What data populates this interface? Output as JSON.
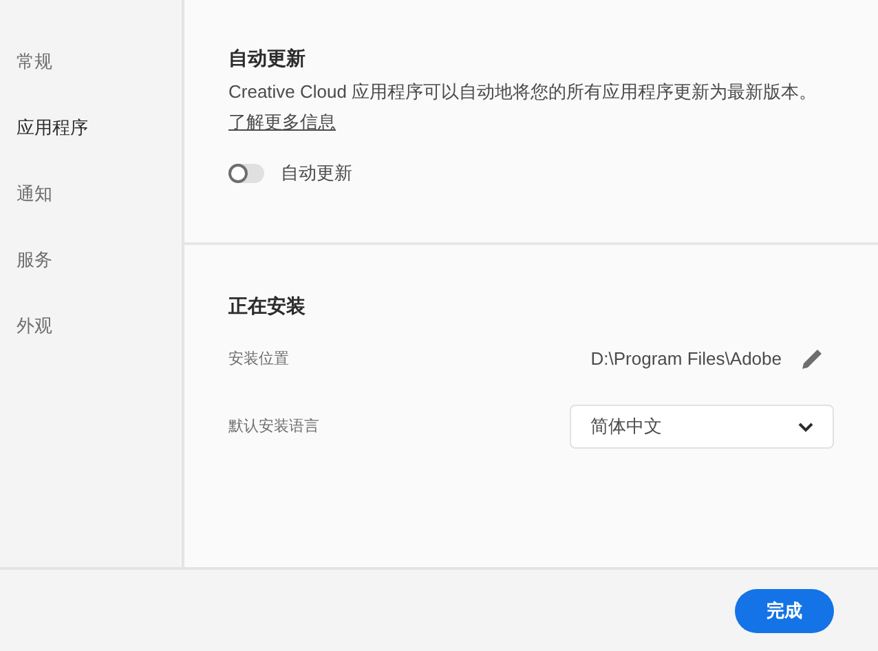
{
  "sidebar": {
    "items": [
      {
        "label": "常规",
        "selected": false
      },
      {
        "label": "应用程序",
        "selected": true
      },
      {
        "label": "通知",
        "selected": false
      },
      {
        "label": "服务",
        "selected": false
      },
      {
        "label": "外观",
        "selected": false
      }
    ]
  },
  "auto_update": {
    "title": "自动更新",
    "description": "Creative Cloud 应用程序可以自动地将您的所有应用程序更新为最新版本。",
    "link": "了解更多信息",
    "toggle": {
      "label": "自动更新",
      "on": false
    }
  },
  "installing": {
    "title": "正在安装",
    "location": {
      "label": "安装位置",
      "value": "D:\\Program Files\\Adobe"
    },
    "language": {
      "label": "默认安装语言",
      "value": "简体中文"
    }
  },
  "footer": {
    "button": "完成"
  }
}
